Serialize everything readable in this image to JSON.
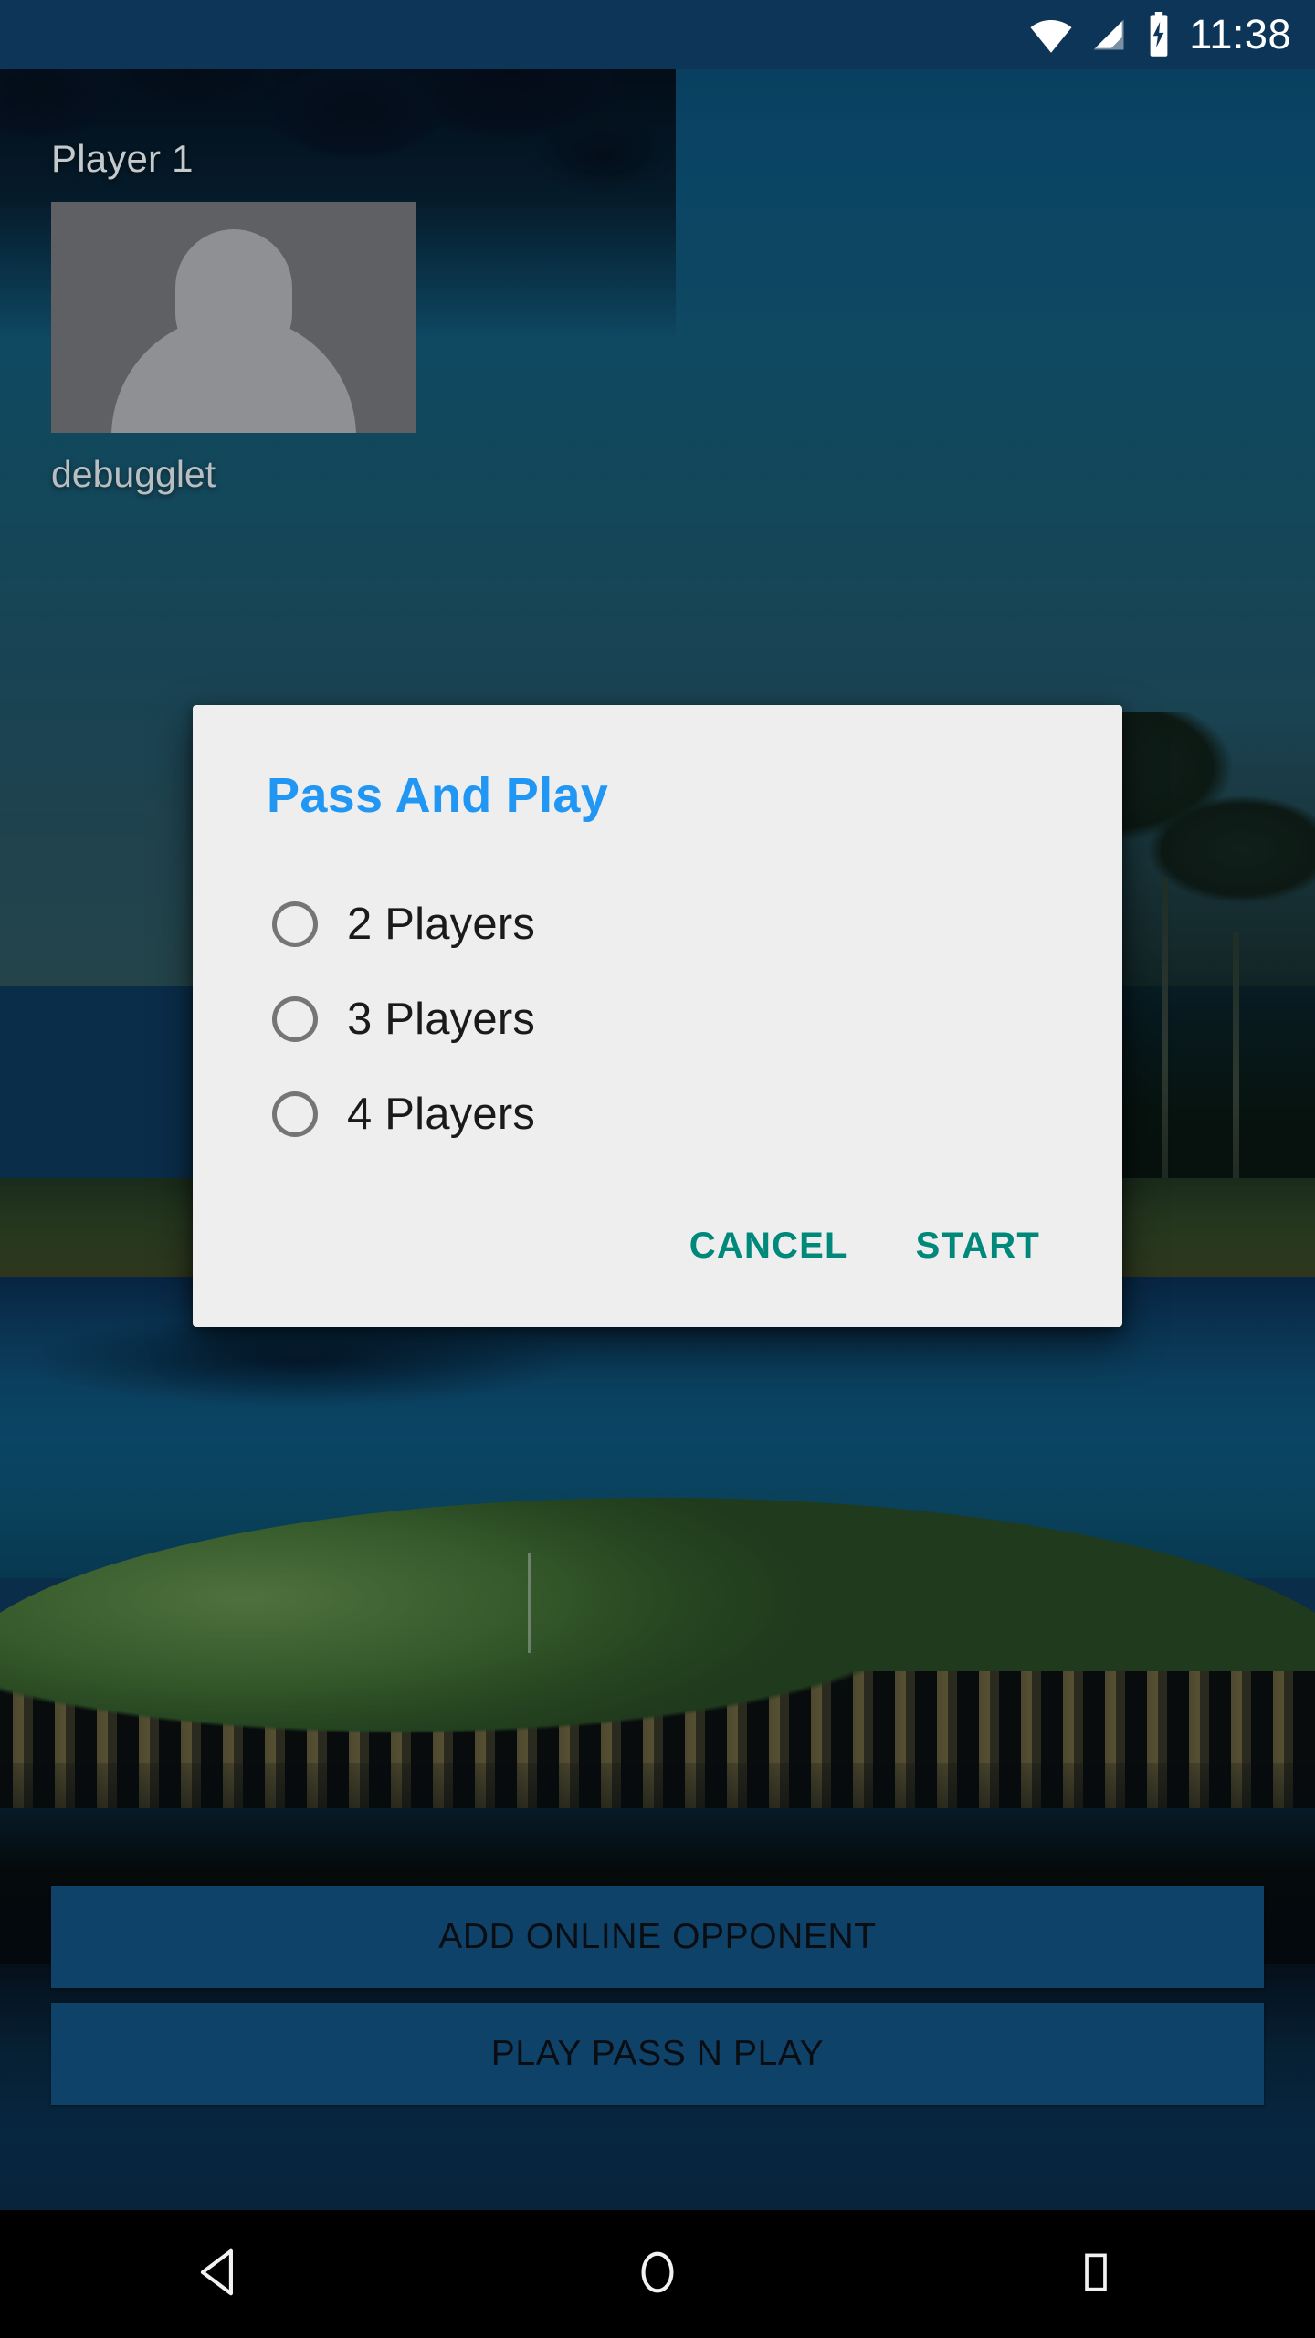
{
  "status_bar": {
    "time": "11:38",
    "icons": [
      "wifi-icon",
      "cellular-signal-icon",
      "battery-charging-icon"
    ],
    "background_color": "#0d3558"
  },
  "screen": {
    "background_description": "golf-course-photo"
  },
  "player_slot": {
    "label": "Player 1",
    "avatar_icon": "default-person-avatar",
    "username": "debugglet"
  },
  "dialog": {
    "title": "Pass And Play",
    "title_color": "#2196f3",
    "background_color": "#eeeeee",
    "options": [
      {
        "label": "2 Players",
        "selected": false
      },
      {
        "label": "3 Players",
        "selected": false
      },
      {
        "label": "4 Players",
        "selected": false
      }
    ],
    "actions": {
      "cancel_label": "CANCEL",
      "start_label": "START",
      "color": "#00897b"
    }
  },
  "bottom_buttons": [
    {
      "label": "ADD ONLINE OPPONENT",
      "color": "#0f4269"
    },
    {
      "label": "PLAY PASS N PLAY",
      "color": "#0f4269"
    }
  ],
  "nav_bar": {
    "back_icon": "back-triangle-icon",
    "home_icon": "home-circle-icon",
    "recents_icon": "recents-square-icon"
  }
}
